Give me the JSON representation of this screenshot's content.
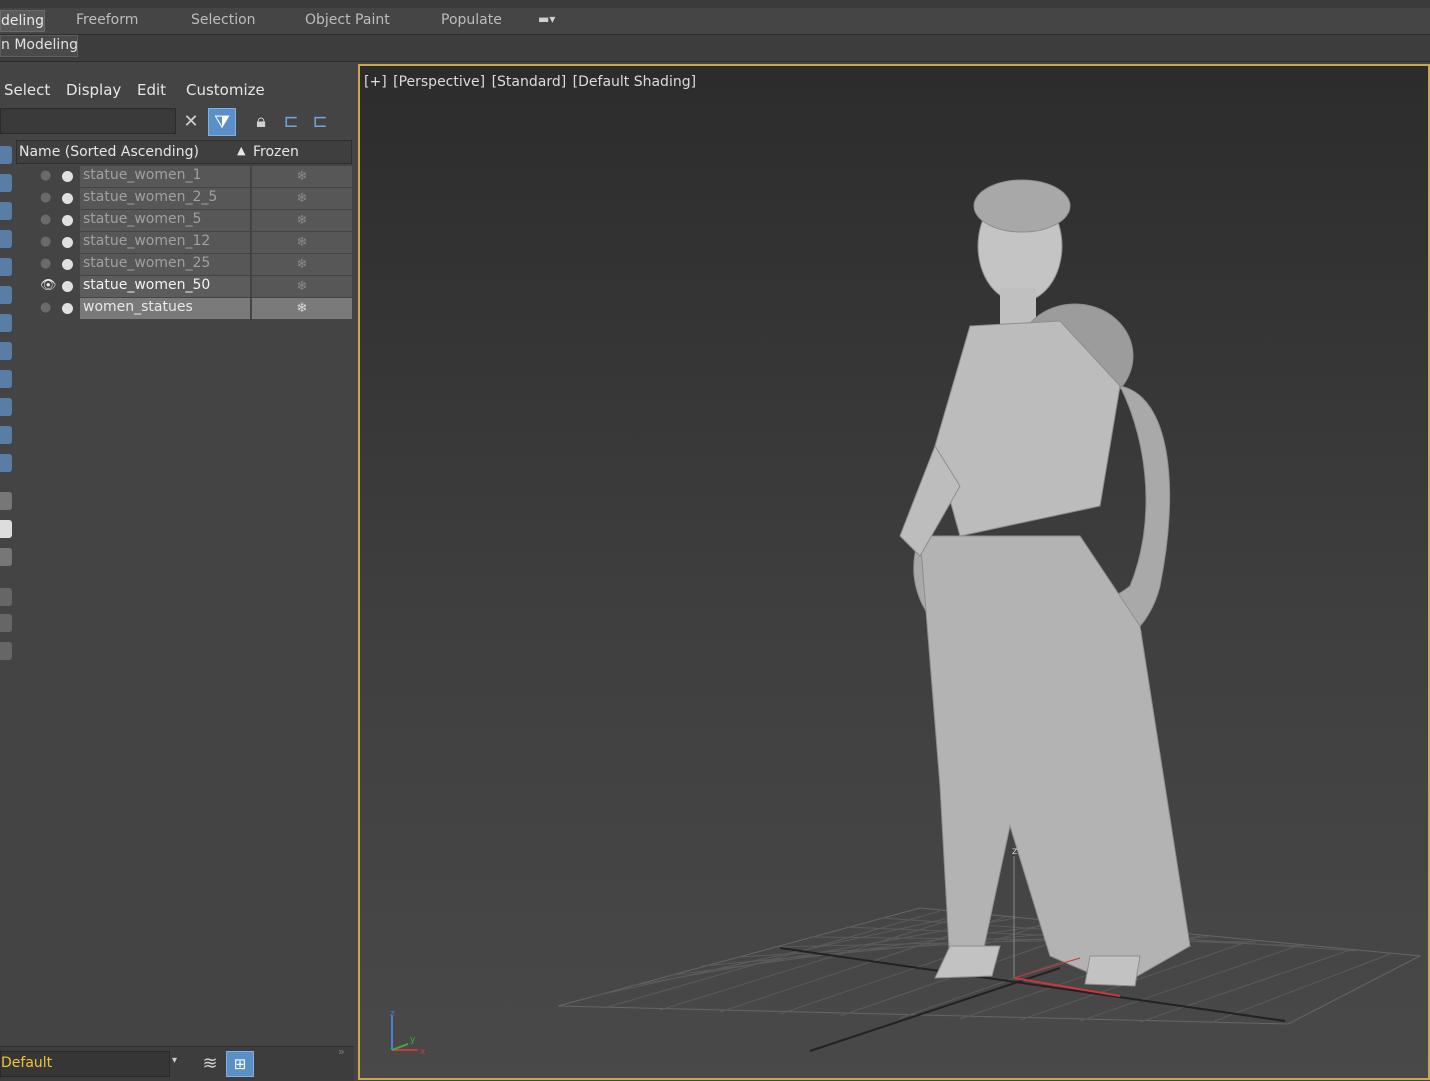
{
  "ribbon": {
    "tabs": [
      "deling",
      "Freeform",
      "Selection",
      "Object Paint",
      "Populate"
    ],
    "sub_label": "n Modeling"
  },
  "explorer": {
    "menus": [
      "Select",
      "Display",
      "Edit",
      "Customize"
    ],
    "columns": {
      "name": "Name (Sorted Ascending)",
      "frozen": "Frozen"
    },
    "rows": [
      {
        "name": "statue_women_1"
      },
      {
        "name": "statue_women_2_5"
      },
      {
        "name": "statue_women_5"
      },
      {
        "name": "statue_women_12"
      },
      {
        "name": "statue_women_25"
      },
      {
        "name": "statue_women_50"
      },
      {
        "name": "women_statues"
      }
    ],
    "layer": "Default"
  },
  "viewport": {
    "labels": [
      "[+]",
      "[Perspective]",
      "[Standard]",
      "[Default Shading]"
    ],
    "axes": {
      "z": "z",
      "y": "y",
      "x": "x"
    }
  },
  "colors": {
    "accent": "#5b8fc7",
    "viewport_border": "#c9a84a",
    "layer_text": "#f0c43a"
  }
}
